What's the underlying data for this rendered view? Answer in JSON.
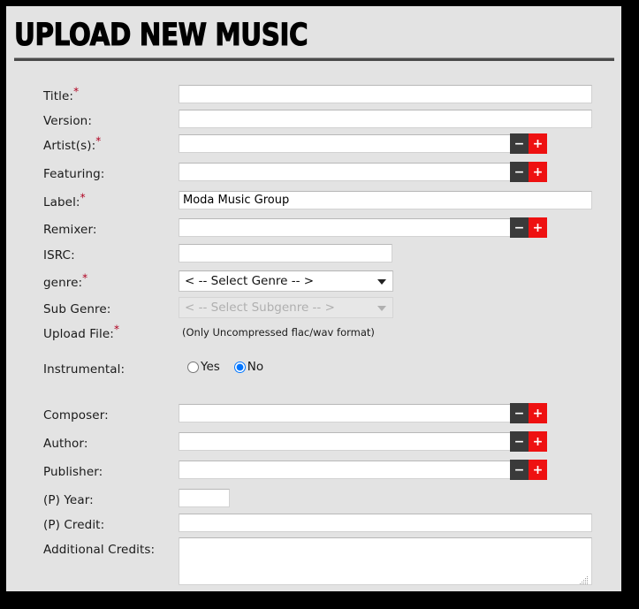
{
  "header": {
    "title": "UPLOAD NEW MUSIC"
  },
  "colors": {
    "page_background": "#e3e3e3",
    "frame_border": "#000000",
    "minus_button": "#3a3a3a",
    "plus_button": "#ee1111",
    "required_asterisk": "#b00020",
    "title_text": "#000000",
    "rule": "#4a4a4a"
  },
  "icons": {
    "minus": "−",
    "plus": "+",
    "chevron_down": "▼"
  },
  "form": {
    "required_marker": "*",
    "rows": [
      {
        "key": "title",
        "label": "Title:",
        "required": true,
        "type": "text",
        "value": "",
        "placeholder": ""
      },
      {
        "key": "version",
        "label": "Version:",
        "required": false,
        "type": "text",
        "value": "",
        "placeholder": ""
      },
      {
        "key": "artists",
        "label": "Artist(s):",
        "required": true,
        "type": "text_pm",
        "value": "",
        "placeholder": ""
      },
      {
        "key": "featuring",
        "label": "Featuring:",
        "required": false,
        "type": "text_pm",
        "value": "",
        "placeholder": ""
      },
      {
        "key": "label",
        "label": "Label:",
        "required": true,
        "type": "text",
        "value": "Moda Music Group",
        "placeholder": ""
      },
      {
        "key": "remixer",
        "label": "Remixer:",
        "required": false,
        "type": "text_pm",
        "value": "",
        "placeholder": ""
      },
      {
        "key": "isrc",
        "label": "ISRC:",
        "required": false,
        "type": "text",
        "value": "",
        "placeholder": ""
      },
      {
        "key": "genre",
        "label": "genre:",
        "required": true,
        "type": "select",
        "value": "< -- Select Genre -- >",
        "disabled": false
      },
      {
        "key": "sub_genre",
        "label": "Sub Genre:",
        "required": false,
        "type": "select",
        "value": "< -- Select Subgenre -- >",
        "disabled": true
      },
      {
        "key": "upload_file",
        "label": "Upload File:",
        "required": true,
        "type": "note",
        "value": "(Only Uncompressed flac/wav format)"
      },
      {
        "key": "instrumental",
        "label": "Instrumental:",
        "required": false,
        "type": "radio",
        "value": "No"
      },
      {
        "key": "composer",
        "label": "Composer:",
        "required": false,
        "type": "text_pm",
        "value": "",
        "placeholder": ""
      },
      {
        "key": "author",
        "label": "Author:",
        "required": false,
        "type": "text_pm",
        "value": "",
        "placeholder": ""
      },
      {
        "key": "publisher",
        "label": "Publisher:",
        "required": false,
        "type": "text_pm",
        "value": "",
        "placeholder": ""
      },
      {
        "key": "p_year",
        "label": "(P) Year:",
        "required": false,
        "type": "text",
        "value": "",
        "placeholder": ""
      },
      {
        "key": "p_credit",
        "label": "(P) Credit:",
        "required": false,
        "type": "text",
        "value": "",
        "placeholder": ""
      },
      {
        "key": "additional",
        "label": "Additional Credits:",
        "required": false,
        "type": "textarea",
        "value": "",
        "placeholder": ""
      }
    ],
    "genre_options": [
      "< -- Select Genre -- >"
    ],
    "subgenre_options": [
      "< -- Select Subgenre -- >"
    ],
    "instrumental_options": [
      {
        "label": "Yes",
        "value": "Yes",
        "selected": false
      },
      {
        "label": "No",
        "value": "No",
        "selected": true
      }
    ]
  }
}
